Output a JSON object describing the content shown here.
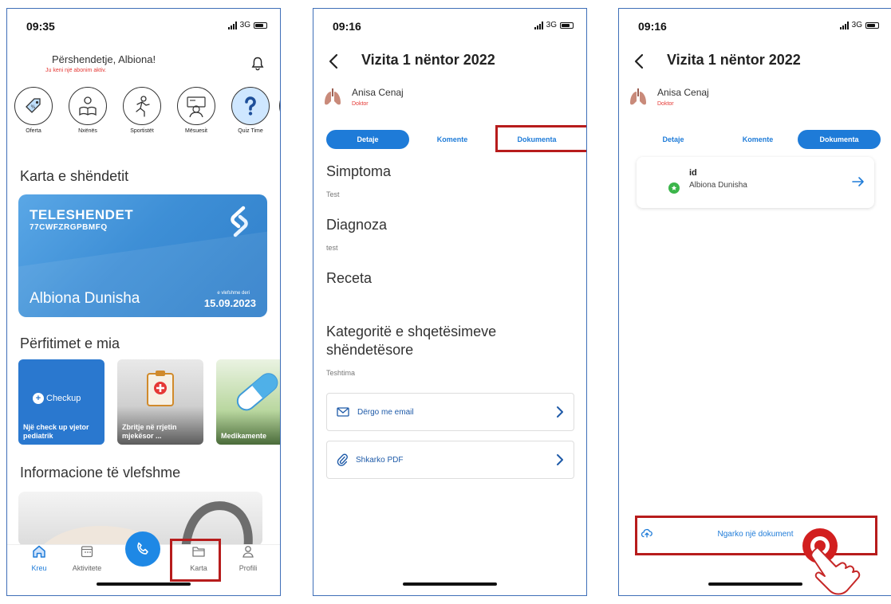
{
  "phone_home": {
    "time": "09:35",
    "network": "3G",
    "greeting": "Përshendetje, Albiona!",
    "subscription_note": "Ju keni një abonim aktiv.",
    "categories": [
      {
        "label": "Oferta",
        "icon": "tag-icon"
      },
      {
        "label": "Nxënës",
        "icon": "student-icon"
      },
      {
        "label": "Sportistët",
        "icon": "athlete-icon"
      },
      {
        "label": "Mësuesit",
        "icon": "teacher-icon"
      },
      {
        "label": "Quiz Time",
        "icon": "question-icon"
      }
    ],
    "health_card_title": "Karta e shëndetit",
    "card": {
      "brand": "TELESHENDET",
      "code": "77CWFZRGPBMFQ",
      "holder": "Albiona Dunisha",
      "valid_label": "e vlefshme deri",
      "valid_date": "15.09.2023"
    },
    "benefits_title": "Përfitimet e mia",
    "benefits": [
      {
        "label": "Një check up vjetor pediatrik",
        "logo_text": "Checkup"
      },
      {
        "label": "Zbritje në rrjetin mjekësor ..."
      },
      {
        "label": "Medikamente"
      }
    ],
    "info_title": "Informacione të vlefshme",
    "tabs": [
      {
        "label": "Kreu",
        "icon": "home-icon"
      },
      {
        "label": "Aktivitete",
        "icon": "calendar-icon"
      },
      {
        "label": "Karta",
        "icon": "folder-icon"
      },
      {
        "label": "Profili",
        "icon": "user-icon"
      }
    ],
    "active_tab": "Kreu",
    "highlighted_tab": "Karta",
    "accent": "#1e7bd8",
    "highlight_color": "#b71c1c"
  },
  "phone_visit_details": {
    "time": "09:16",
    "network": "3G",
    "title": "Vizita 1 nëntor 2022",
    "doctor_name": "Anisa Cenaj",
    "doctor_role": "Doktor",
    "segments": [
      "Detaje",
      "Komente",
      "Dokumenta"
    ],
    "active_segment": "Detaje",
    "highlighted_segment": "Dokumenta",
    "fields": [
      {
        "title": "Simptoma",
        "value": "Test"
      },
      {
        "title": "Diagnoza",
        "value": "test"
      },
      {
        "title": "Receta",
        "value": ""
      },
      {
        "title": "Kategoritë e shqetësimeve shëndetësore",
        "value": "Teshtima"
      }
    ],
    "actions": [
      {
        "label": "Dërgo me email",
        "icon": "mail-icon"
      },
      {
        "label": "Shkarko PDF",
        "icon": "paperclip-icon"
      }
    ]
  },
  "phone_visit_documents": {
    "time": "09:16",
    "network": "3G",
    "title": "Vizita 1 nëntor 2022",
    "doctor_name": "Anisa Cenaj",
    "doctor_role": "Doktor",
    "segments": [
      "Detaje",
      "Komente",
      "Dokumenta"
    ],
    "active_segment": "Dokumenta",
    "document": {
      "title": "id",
      "owner": "Albiona Dunisha"
    },
    "upload_label": "Ngarko një dokument"
  }
}
